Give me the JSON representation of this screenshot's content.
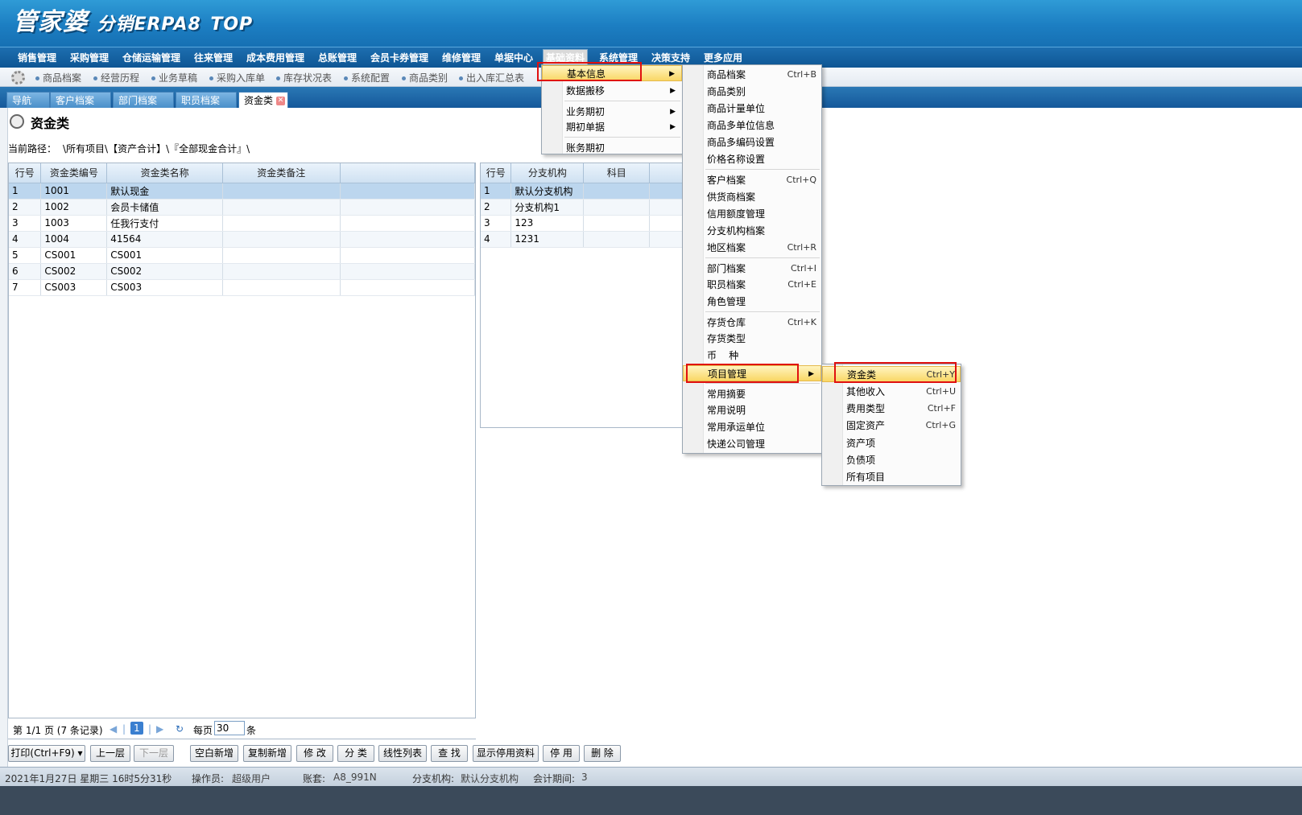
{
  "banner": {
    "brand": "管家婆",
    "product": "分销ERPA8",
    "edition": "TOP"
  },
  "menubar": [
    "销售管理",
    "采购管理",
    "仓储运输管理",
    "往来管理",
    "成本费用管理",
    "总账管理",
    "会员卡券管理",
    "维修管理",
    "单据中心",
    "基础资料",
    "系统管理",
    "决策支持",
    "更多应用"
  ],
  "quickbar": [
    "商品档案",
    "经营历程",
    "业务草稿",
    "采购入库单",
    "库存状况表",
    "系统配置",
    "商品类别",
    "出入库汇总表"
  ],
  "tabs": [
    "导航",
    "客户档案",
    "部门档案",
    "职员档案",
    "资金类"
  ],
  "page": {
    "title": "资金类",
    "path_label": "当前路径：",
    "path_value": "\\所有项目\\【资产合计】\\『全部现金合计』\\"
  },
  "left_grid": {
    "headers": [
      "行号",
      "资金类编号",
      "资金类名称",
      "资金类备注",
      ""
    ],
    "rows": [
      [
        "1",
        "1001",
        "默认现金",
        ""
      ],
      [
        "2",
        "1002",
        "会员卡储值",
        ""
      ],
      [
        "3",
        "1003",
        "任我行支付",
        ""
      ],
      [
        "4",
        "1004",
        "41564",
        ""
      ],
      [
        "5",
        "CS001",
        "CS001",
        ""
      ],
      [
        "6",
        "CS002",
        "CS002",
        ""
      ],
      [
        "7",
        "CS003",
        "CS003",
        ""
      ]
    ]
  },
  "right_grid": {
    "headers": [
      "行号",
      "分支机构",
      "科目"
    ],
    "rows": [
      [
        "1",
        "默认分支机构",
        ""
      ],
      [
        "2",
        "分支机构1",
        ""
      ],
      [
        "3",
        "123",
        ""
      ],
      [
        "4",
        "1231",
        ""
      ]
    ]
  },
  "pager": {
    "page_text": "第  1/1 页  (7 条记录)",
    "current": "1",
    "per_page_label": "每页",
    "per_page_value": "30",
    "unit": "条"
  },
  "buttons": {
    "print": "打印(Ctrl+F9)",
    "up": "上一层",
    "down": "下一层",
    "blank_new": "空白新增",
    "copy_new": "复制新增",
    "edit": "修 改",
    "classify": "分 类",
    "linear": "线性列表",
    "find": "查 找",
    "show_disabled": "显示停用资料",
    "disable": "停 用",
    "delete": "删 除"
  },
  "status": {
    "datetime": "2021年1月27日  星期三   16时5分31秒",
    "operator_label": "操作员:",
    "operator": "超级用户",
    "account_label": "账套:",
    "account": "A8_991N",
    "branch_label": "分支机构:",
    "branch": "默认分支机构",
    "period_label": "会计期间:",
    "period": "3"
  },
  "menu1": {
    "items": [
      "基本信息",
      "数据搬移",
      "业务期初",
      "期初单据",
      "账务期初"
    ]
  },
  "menu2": {
    "items": [
      {
        "label": "商品档案",
        "sc": "Ctrl+B"
      },
      {
        "label": "商品类别",
        "sc": ""
      },
      {
        "label": "商品计量单位",
        "sc": ""
      },
      {
        "label": "商品多单位信息",
        "sc": ""
      },
      {
        "label": "商品多编码设置",
        "sc": ""
      },
      {
        "label": "价格名称设置",
        "sc": ""
      },
      {
        "label": "客户档案",
        "sc": "Ctrl+Q"
      },
      {
        "label": "供货商档案",
        "sc": ""
      },
      {
        "label": "信用额度管理",
        "sc": ""
      },
      {
        "label": "分支机构档案",
        "sc": ""
      },
      {
        "label": "地区档案",
        "sc": "Ctrl+R"
      },
      {
        "label": "部门档案",
        "sc": "Ctrl+I"
      },
      {
        "label": "职员档案",
        "sc": "Ctrl+E"
      },
      {
        "label": "角色管理",
        "sc": ""
      },
      {
        "label": "存货仓库",
        "sc": "Ctrl+K"
      },
      {
        "label": "存货类型",
        "sc": ""
      },
      {
        "label": "币    种",
        "sc": ""
      },
      {
        "label": "项目管理",
        "sc": ""
      },
      {
        "label": "常用摘要",
        "sc": ""
      },
      {
        "label": "常用说明",
        "sc": ""
      },
      {
        "label": "常用承运单位",
        "sc": ""
      },
      {
        "label": "快递公司管理",
        "sc": ""
      }
    ]
  },
  "menu3": {
    "items": [
      {
        "label": "资金类",
        "sc": "Ctrl+Y"
      },
      {
        "label": "其他收入",
        "sc": "Ctrl+U"
      },
      {
        "label": "费用类型",
        "sc": "Ctrl+F"
      },
      {
        "label": "固定资产",
        "sc": "Ctrl+G"
      },
      {
        "label": "资产项",
        "sc": ""
      },
      {
        "label": "负债项",
        "sc": ""
      },
      {
        "label": "所有项目",
        "sc": ""
      }
    ]
  }
}
